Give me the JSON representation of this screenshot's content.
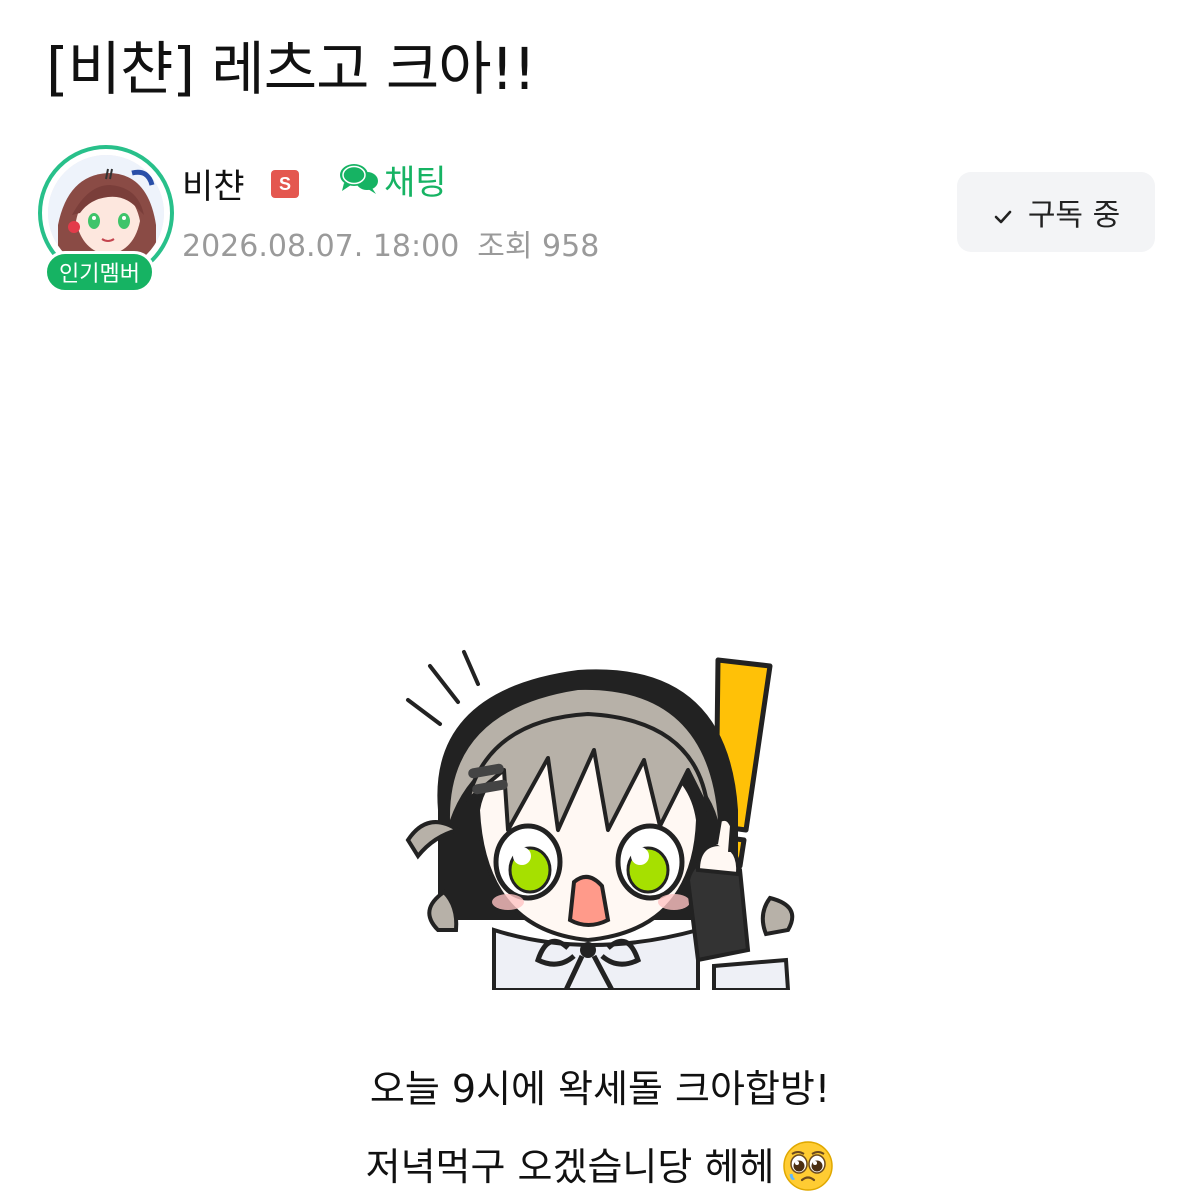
{
  "post": {
    "title": "[비챤] 레츠고 크아!!"
  },
  "author": {
    "name": "비챤",
    "staff_badge": "S",
    "popular_badge": "인기멤버",
    "chat_label": "채팅",
    "date": "2026.08.07. 18:00",
    "views": "조회 958"
  },
  "subscribe": {
    "label": "구독 중"
  },
  "content": {
    "line1": "오늘 9시에 왁세돌 크아합방!",
    "line2": "저녁먹구 오겠습니당 헤헤"
  },
  "colors": {
    "accent_green": "#16b363",
    "staff_red": "#e4574f",
    "meta_gray": "#9a9a9a",
    "exclaim_yellow": "#ffc107",
    "eye_green": "#a6e000"
  },
  "icons": {
    "chat": "speech-bubbles-icon",
    "check": "check-icon",
    "emoji": "pleading-face-icon"
  }
}
